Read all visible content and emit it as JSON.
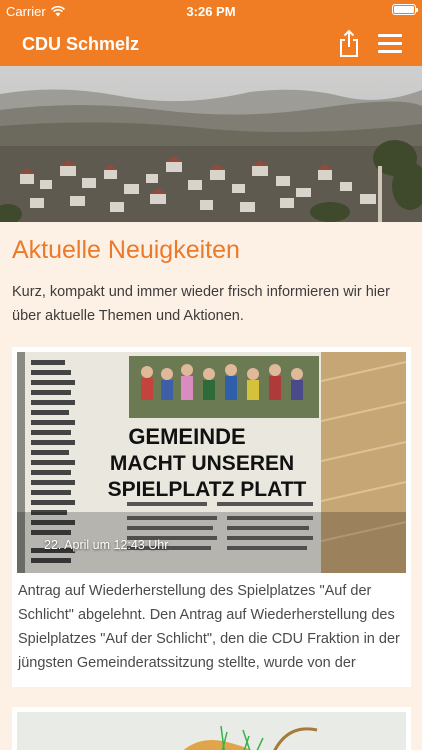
{
  "status_bar": {
    "carrier": "Carrier",
    "time": "3:26 PM",
    "wifi_icon": "wifi-icon",
    "battery_icon": "battery-icon",
    "battery_level": 1.0
  },
  "nav": {
    "title": "CDU Schmelz",
    "share_icon": "share-icon",
    "menu_icon": "hamburger-menu-icon"
  },
  "section": {
    "title": "Aktuelle Neuigkeiten",
    "intro": "Kurz, kompakt und immer wieder frisch informieren wir hier über aktuelle Themen und Aktionen."
  },
  "articles": [
    {
      "date": "22. April um 12:43 Uhr",
      "text": "Antrag auf Wiederherstellung des Spielplatzes \"Auf der Schlicht\" abgelehnt. Den Antrag auf Wiederherstellung des Spielplatzes \"Auf der Schlicht\", den die CDU Fraktion in der jüngsten Gemeinderatssitzung stellte, wurde von der"
    }
  ],
  "colors": {
    "accent": "#f07d23",
    "heading": "#ec7a2a",
    "background": "#fdf1e6",
    "card": "#ffffff"
  }
}
